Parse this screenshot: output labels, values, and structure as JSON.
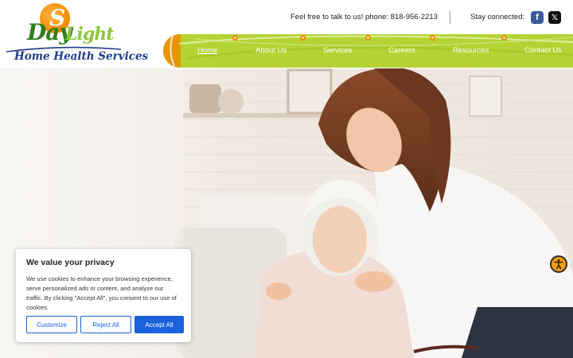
{
  "brand": {
    "logo_s": "S",
    "logo_day": "Day",
    "logo_light": "Light",
    "logo_sub": "Home Health Services"
  },
  "header": {
    "contact_text": "Feel free to talk to us! phone: 818-956-2213",
    "stay_connected": "Stay connected:",
    "social": [
      {
        "name": "facebook",
        "glyph": "f"
      },
      {
        "name": "x-twitter",
        "glyph": "𝕏"
      }
    ]
  },
  "nav": {
    "items": [
      {
        "label": "Home",
        "active": true
      },
      {
        "label": "About Us",
        "active": false
      },
      {
        "label": "Services",
        "active": false
      },
      {
        "label": "Careers",
        "active": false
      },
      {
        "label": "Resources",
        "active": false
      },
      {
        "label": "Contact Us",
        "active": false
      }
    ],
    "bar_color": "#b5d334",
    "accent_color": "#f08a00"
  },
  "cookie": {
    "title": "We value your privacy",
    "body": "We use cookies to enhance your browsing experience, serve personalized ads or content, and analyze our traffic. By clicking \"Accept All\", you consent to our use of cookies.",
    "customize_label": "Customize",
    "reject_label": "Reject All",
    "accept_label": "Accept All",
    "button_color": "#1863dc"
  },
  "accessibility": {
    "icon": "accessibility-icon"
  }
}
